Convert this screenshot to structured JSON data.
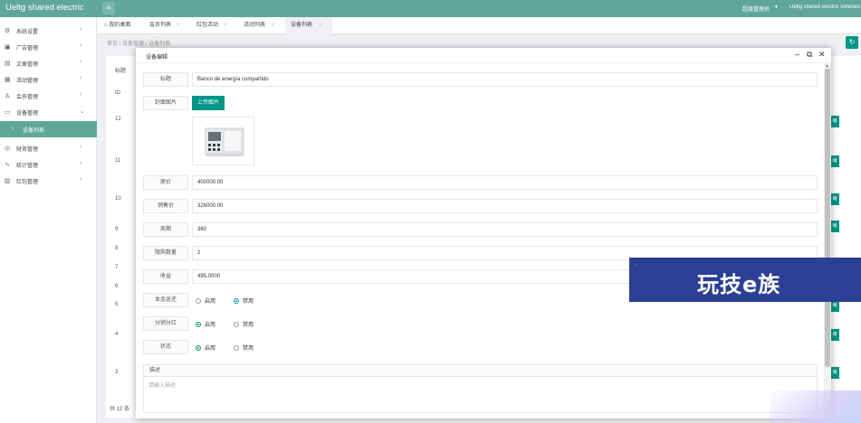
{
  "app": {
    "title": "Ueltg shared electric",
    "admin_name": "超级管理员",
    "site_name": "Ueltg shared electric vehicles"
  },
  "sidebar": {
    "items": [
      {
        "label": "系统设置",
        "icon": "gear-icon"
      },
      {
        "label": "广告管理",
        "icon": "image-icon"
      },
      {
        "label": "文章管理",
        "icon": "document-icon"
      },
      {
        "label": "活动管理",
        "icon": "calendar-icon"
      },
      {
        "label": "会员管理",
        "icon": "user-icon"
      },
      {
        "label": "设备管理",
        "icon": "device-icon"
      },
      {
        "label": "设备列表",
        "icon": "chevron-right-icon",
        "active": true
      },
      {
        "label": "财务管理",
        "icon": "money-icon"
      },
      {
        "label": "统计管理",
        "icon": "chart-icon"
      },
      {
        "label": "红包管理",
        "icon": "gift-icon"
      }
    ]
  },
  "tabs": [
    {
      "label": "我的桌面"
    },
    {
      "label": "会员列表"
    },
    {
      "label": "红包活动"
    },
    {
      "label": "活动列表"
    },
    {
      "label": "设备列表",
      "active": true
    }
  ],
  "breadcrumb": [
    "首页",
    "设备管理",
    "设备列表"
  ],
  "background_table": {
    "header_label": "标题",
    "id_header": "ID",
    "ids": [
      "12",
      "11",
      "10",
      "9",
      "8",
      "7",
      "6",
      "5",
      "4",
      "3"
    ],
    "total": "共 12 条"
  },
  "modal": {
    "title": "设备编辑",
    "fields": {
      "title_label": "标题",
      "title_value": "Banco de energía compartido",
      "cover_label": "封面图片",
      "upload_label": "上传图片",
      "price_label": "原价",
      "price_value": "400000.00",
      "sale_price_label": "销售价",
      "sale_price_value": "326000.00",
      "cycle_label": "周期",
      "cycle_value": "360",
      "limit_label": "限购数量",
      "limit_value": "2",
      "income_label": "收益",
      "income_value": "495.0000",
      "principal_label": "本金返还",
      "dividend_label": "分销分红",
      "status_label": "状态",
      "enable_label": "启用",
      "disable_label": "禁用",
      "principal_selected": "禁用",
      "dividend_selected": "启用",
      "status_selected": "启用",
      "desc_label": "描述",
      "desc_placeholder": "请输入描述"
    }
  },
  "watermark": {
    "text": "玩技e族"
  },
  "colors": {
    "brand": "#5fa79a",
    "accent": "#009688",
    "watermark_bg": "#2b3f94"
  }
}
